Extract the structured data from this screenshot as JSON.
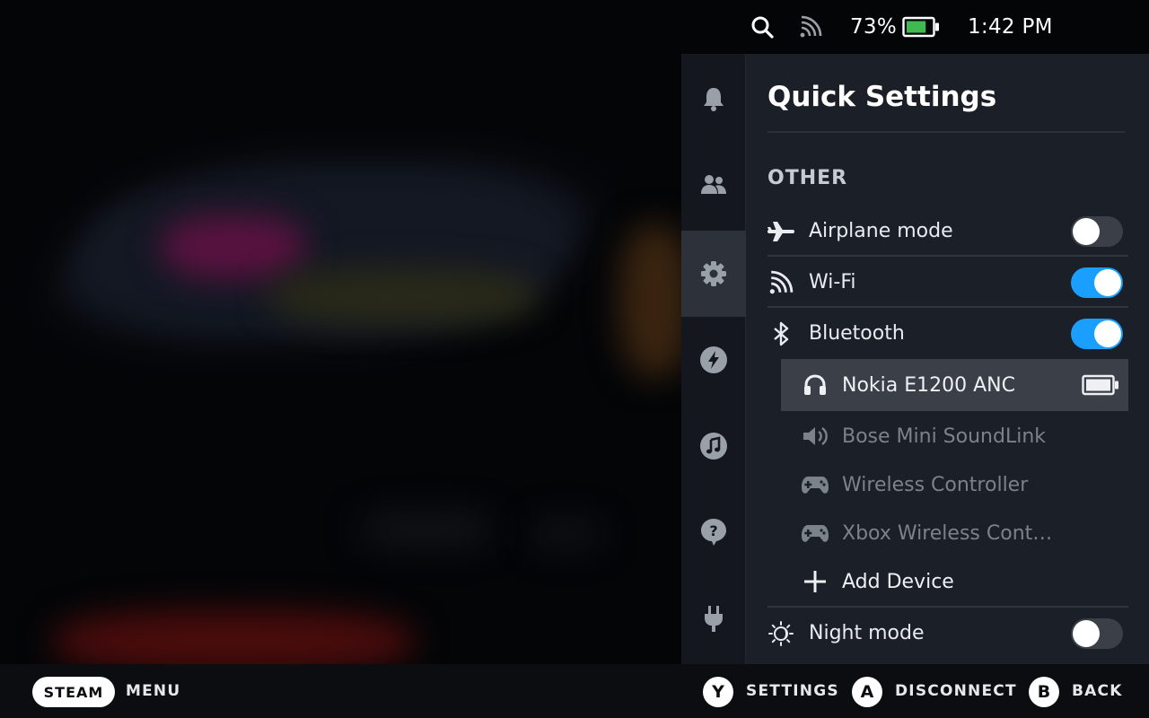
{
  "status": {
    "battery_percent": "73%",
    "battery_level": 0.73,
    "time": "1:42 PM"
  },
  "rail": {
    "items": [
      {
        "name": "notifications",
        "icon": "bell-icon"
      },
      {
        "name": "friends",
        "icon": "friends-icon"
      },
      {
        "name": "settings",
        "icon": "gear-icon",
        "active": true
      },
      {
        "name": "performance",
        "icon": "lightning-icon"
      },
      {
        "name": "music",
        "icon": "music-note-icon"
      },
      {
        "name": "help",
        "icon": "question-icon"
      },
      {
        "name": "power",
        "icon": "plug-icon"
      }
    ]
  },
  "quick_settings": {
    "title": "Quick Settings",
    "section": "OTHER",
    "airplane": {
      "label": "Airplane mode",
      "on": false,
      "icon": "airplane-icon"
    },
    "wifi": {
      "label": "Wi-Fi",
      "on": true,
      "icon": "wifi-icon"
    },
    "bluetooth": {
      "label": "Bluetooth",
      "on": true,
      "icon": "bluetooth-icon"
    },
    "devices": [
      {
        "label": "Nokia E1200 ANC",
        "icon": "headphones-icon",
        "connected": true
      },
      {
        "label": "Bose Mini SoundLink",
        "icon": "speaker-icon",
        "connected": false
      },
      {
        "label": "Wireless Controller",
        "icon": "gamepad-icon",
        "connected": false
      },
      {
        "label": "Xbox Wireless Cont…",
        "icon": "gamepad-icon",
        "connected": false
      }
    ],
    "add_device": {
      "label": "Add Device",
      "icon": "plus-icon"
    },
    "night_mode": {
      "label": "Night mode",
      "on": false,
      "icon": "night-mode-icon"
    }
  },
  "footer": {
    "steam_label": "STEAM",
    "menu_label": "MENU",
    "y_button": "Y",
    "y_label": "SETTINGS",
    "a_button": "A",
    "a_label": "DISCONNECT",
    "b_button": "B",
    "b_label": "BACK"
  },
  "colors": {
    "accent": "#1a9fff",
    "panel": "#1b1f27",
    "rail": "#14171d",
    "selected_row": "#3a3f48",
    "battery_green": "#3fb950"
  }
}
